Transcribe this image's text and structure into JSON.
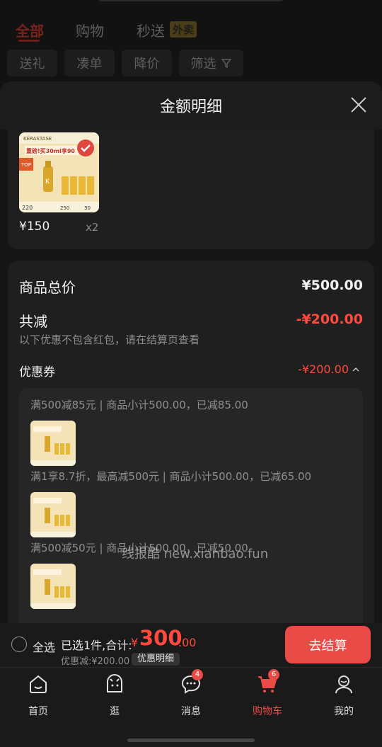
{
  "category_tabs": [
    {
      "label": "全部"
    },
    {
      "label": "购物"
    },
    {
      "label": "秒送"
    }
  ],
  "waimai_badge": "外卖",
  "filters": [
    {
      "label": "送礼"
    },
    {
      "label": "凑单"
    },
    {
      "label": "降价"
    },
    {
      "label": "筛选"
    }
  ],
  "sheet": {
    "title": "金额明细",
    "product": {
      "price": "¥150",
      "qty": "x2",
      "thumb_text": {
        "brand": "KÉRASTASE",
        "promo": "重磅!买30ml享90",
        "badge_top": "TOP",
        "price1": "220",
        "price2": "250",
        "price3": "30"
      }
    },
    "total_label": "商品总价",
    "total_value": "¥500.00",
    "reduce_label": "共减",
    "reduce_value": "-¥200.00",
    "note": "以下优惠不包含红包，请在结算页查看",
    "coupon_label": "优惠券",
    "coupon_value": "-¥200.00",
    "coupons": [
      {
        "text": "满500减85元 | 商品小计500.00，已减85.00"
      },
      {
        "text": "满1享8.7折，最高减500元 | 商品小计500.00，已减65.00"
      },
      {
        "text": "满500减50元 | 商品小计500.00，已减50.00"
      }
    ]
  },
  "watermark": "线报酷 new.xianbao.fun",
  "checkout": {
    "select_all": "全选",
    "selected": "已选1件,合计:",
    "currency": "¥",
    "total_int": "300",
    "total_dec": ".00",
    "discount": "优惠减:¥200.00",
    "detail_btn": "优惠明细",
    "checkout_btn": "去结算"
  },
  "tabbar": [
    {
      "label": "首页",
      "icon": "home-icon"
    },
    {
      "label": "逛",
      "icon": "browse-icon"
    },
    {
      "label": "消息",
      "icon": "message-icon",
      "badge": "4"
    },
    {
      "label": "购物车",
      "icon": "cart-icon",
      "badge": "6",
      "active": true
    },
    {
      "label": "我的",
      "icon": "profile-icon"
    }
  ],
  "colors": {
    "accent": "#ea4b46",
    "price_red": "#ff4a3d",
    "sheet_bg": "#161616",
    "card_bg": "#1f1f1f"
  }
}
